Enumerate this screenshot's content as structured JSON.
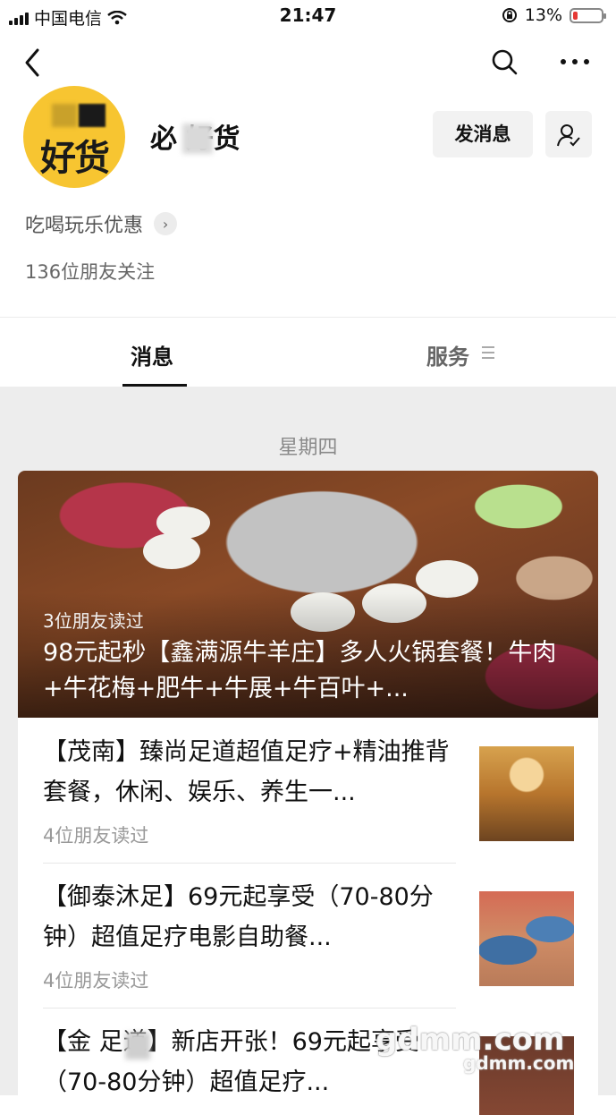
{
  "status_bar": {
    "carrier": "中国电信",
    "time": "21:47",
    "battery": "13%"
  },
  "account": {
    "avatar_text": "好货",
    "name": "必 好货",
    "message_button": "发消息",
    "description": "吃喝玩乐优惠",
    "followers": "136位朋友关注"
  },
  "tabs": {
    "messages": "消息",
    "services": "服务"
  },
  "feed": {
    "date_label": "星期四",
    "featured": {
      "read_count": "3位朋友读过",
      "title": "98元起秒【鑫满源牛羊庄】多人火锅套餐！牛肉+牛花梅+肥牛+牛展+牛百叶+..."
    },
    "articles": [
      {
        "title": "【茂南】臻尚足道超值足疗+精油推背套餐，休闲、娱乐、养生一...",
        "read_count": "4位朋友读过"
      },
      {
        "title": "【御泰沐足】69元起享受（70-80分钟）超值足疗电影自助餐...",
        "read_count": "4位朋友读过"
      },
      {
        "title": "【金 足道】新店开张！69元起享受（70-80分钟）超值足疗..."
      }
    ]
  },
  "watermark": {
    "main": "gdmm.com",
    "sub": "gdmm.com"
  }
}
